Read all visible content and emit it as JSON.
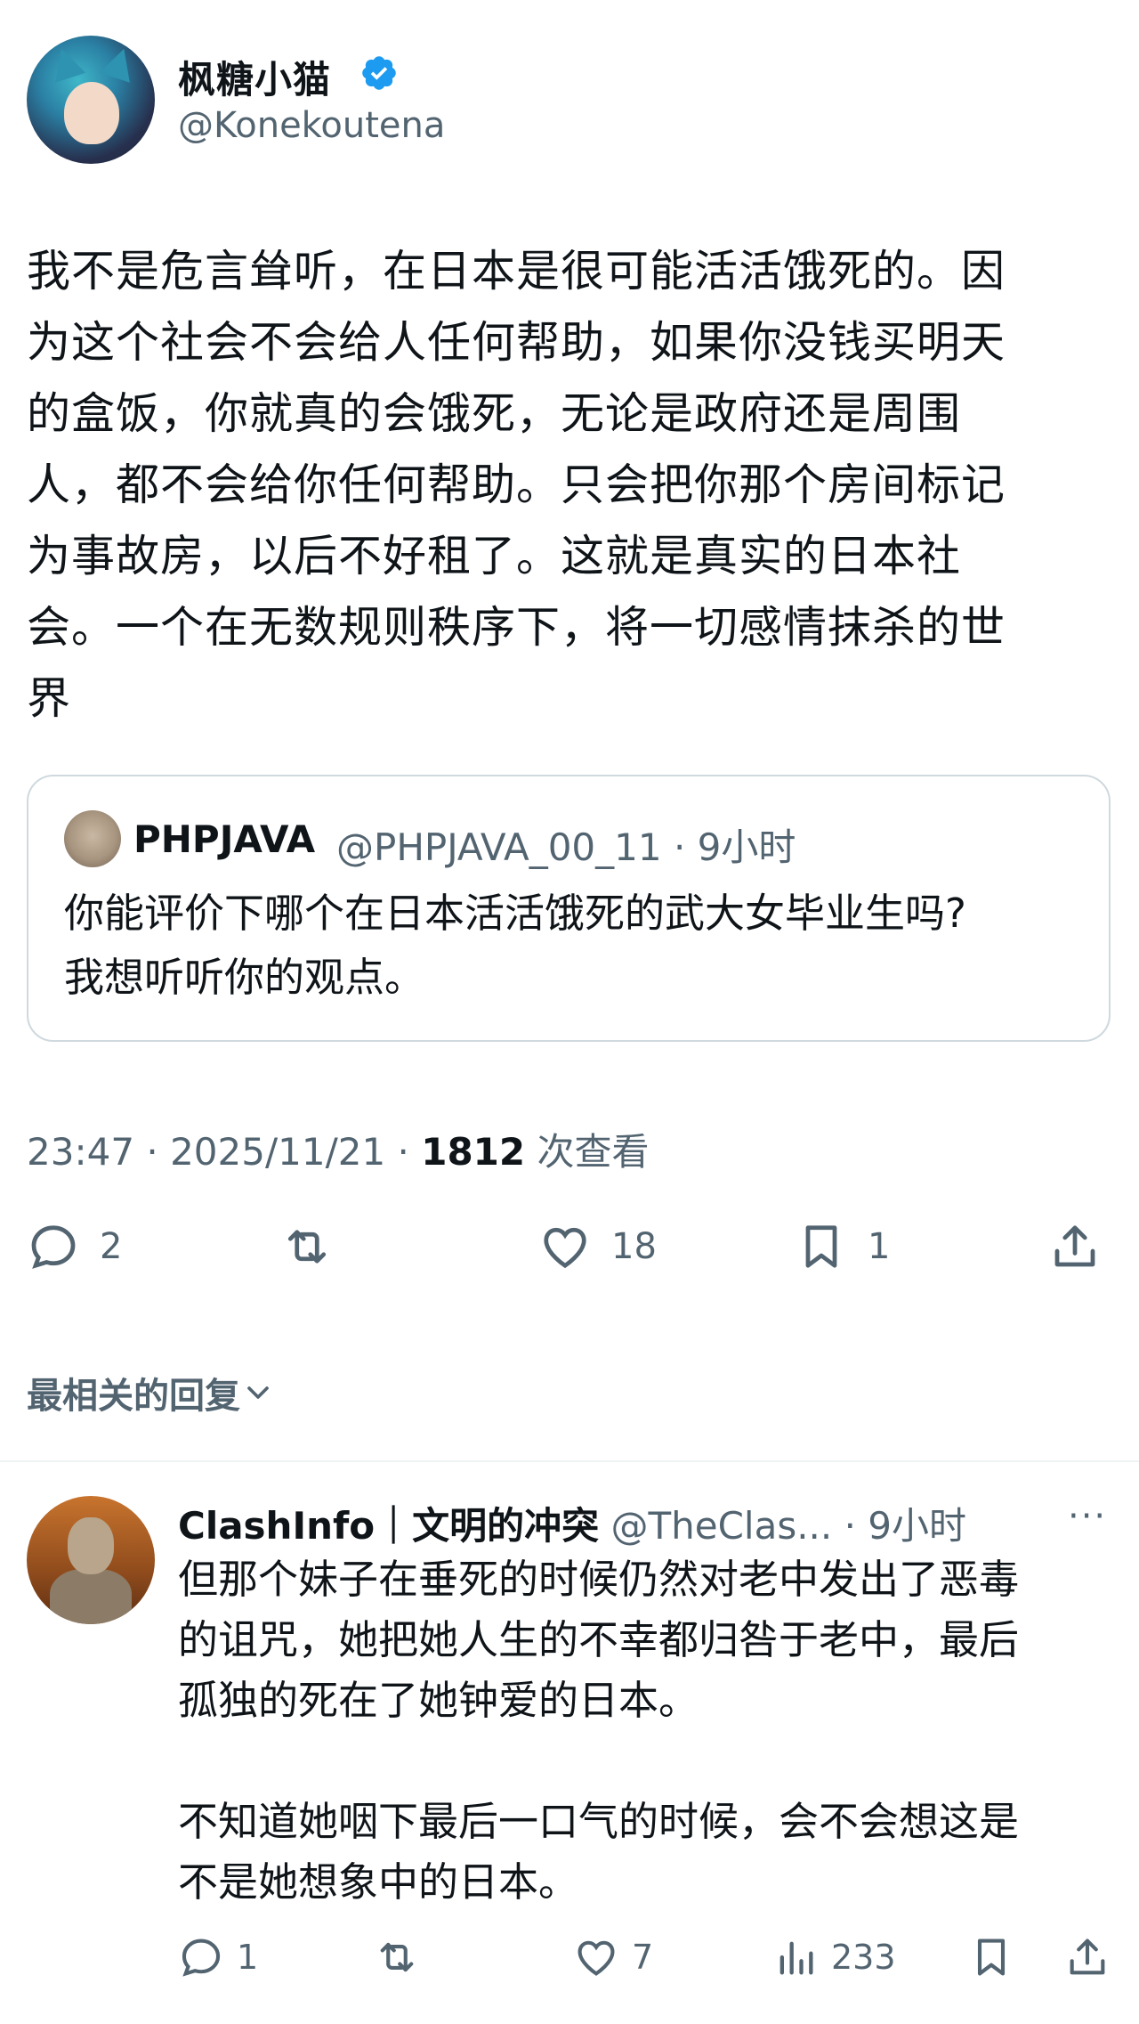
{
  "author": {
    "display_name": "枫糖小猫",
    "handle": "@Konekoutena",
    "verified_icon": "verified-badge-icon",
    "accent_color": "#1d9bf0"
  },
  "post": {
    "lines": [
      "我不是危言耸听，在日本是很可能活活饿死的。因",
      "为这个社会不会给人任何帮助，如果你没钱买明天",
      "的盒饭，你就真的会饿死，无论是政府还是周围",
      "人，都不会给你任何帮助。只会把你那个房间标记",
      "为事故房，以后不好租了。这就是真实的日本社",
      "会。一个在无数规则秩序下，将一切感情抹杀的世",
      "界"
    ]
  },
  "quote": {
    "name": "PHPJAVA",
    "handle_time": "@PHPJAVA_00_11 · 9小时",
    "lines": [
      "你能评价下哪个在日本活活饿死的武大女毕业生吗?",
      "我想听听你的观点。"
    ]
  },
  "meta": {
    "time_date": "23:47 · 2025/11/21 · ",
    "views": "1812",
    "views_label": " 次查看"
  },
  "actions": {
    "replies": "2",
    "retweets": "",
    "likes": "18",
    "bookmarks": "1"
  },
  "sort_label": "最相关的回复",
  "reply": {
    "name": "ClashInfo｜文明的冲突",
    "handle_time": " @TheClas... · 9小时",
    "more": "···",
    "paragraph1": [
      "但那个妹子在垂死的时候仍然对老中发出了恶毒",
      "的诅咒，她把她人生的不幸都归咎于老中，最后",
      "孤独的死在了她钟爱的日本。"
    ],
    "paragraph2": [
      "不知道她咽下最后一口气的时候，会不会想这是",
      "不是她想象中的日本。"
    ],
    "actions": {
      "replies": "1",
      "likes": "7",
      "views": "233"
    }
  }
}
